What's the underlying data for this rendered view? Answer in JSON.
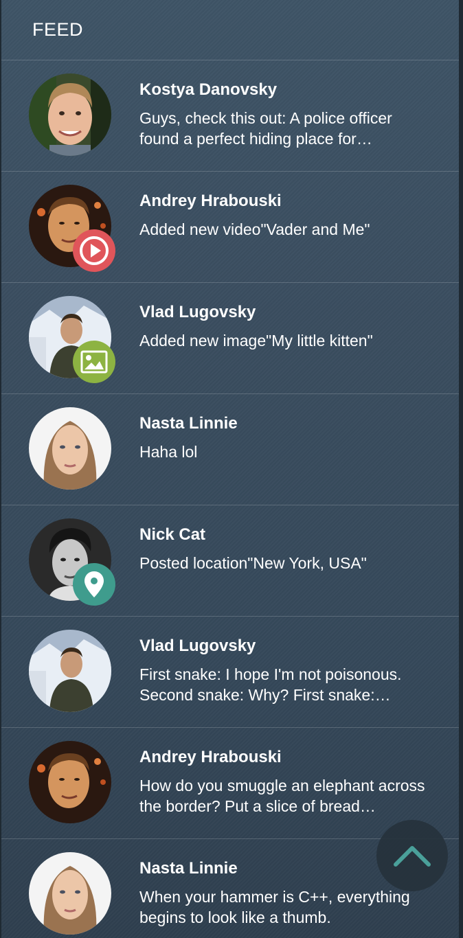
{
  "header": {
    "title": "FEED"
  },
  "feed": [
    {
      "name": "Kostya Danovsky",
      "text": "Guys, check this out: A police officer found a perfect hiding place for…",
      "avatar": "kostya-avatar",
      "badge": ""
    },
    {
      "name": "Andrey Hrabouski",
      "text": "Added new video\"Vader and Me\"",
      "avatar": "andrey-avatar",
      "badge": "play-icon"
    },
    {
      "name": "Vlad Lugovsky",
      "text": "Added new image\"My little kitten\"",
      "avatar": "vlad-avatar",
      "badge": "image-icon"
    },
    {
      "name": "Nasta Linnie",
      "text": "Haha lol",
      "avatar": "nasta-avatar",
      "badge": ""
    },
    {
      "name": "Nick Cat",
      "text": "Posted location\"New York, USA\"",
      "avatar": "nick-avatar",
      "badge": "location-pin-icon"
    },
    {
      "name": "Vlad Lugovsky",
      "text": "First snake: I hope I'm not poisonous. Second snake: Why? First snake:…",
      "avatar": "vlad-avatar",
      "badge": ""
    },
    {
      "name": "Andrey Hrabouski",
      "text": "How do you smuggle an elephant across the border? Put a slice of bread…",
      "avatar": "andrey-avatar",
      "badge": ""
    },
    {
      "name": "Nasta Linnie",
      "text": "When your hammer is C++, everything begins to look like a thumb.",
      "avatar": "nasta-avatar",
      "badge": ""
    }
  ],
  "scroll_top": {
    "icon": "chevron-up-icon"
  },
  "colors": {
    "video_badge": "#e0555a",
    "image_badge": "#8db342",
    "location_badge": "#3f9c8d",
    "scroll_chevron": "#4aa09a"
  }
}
